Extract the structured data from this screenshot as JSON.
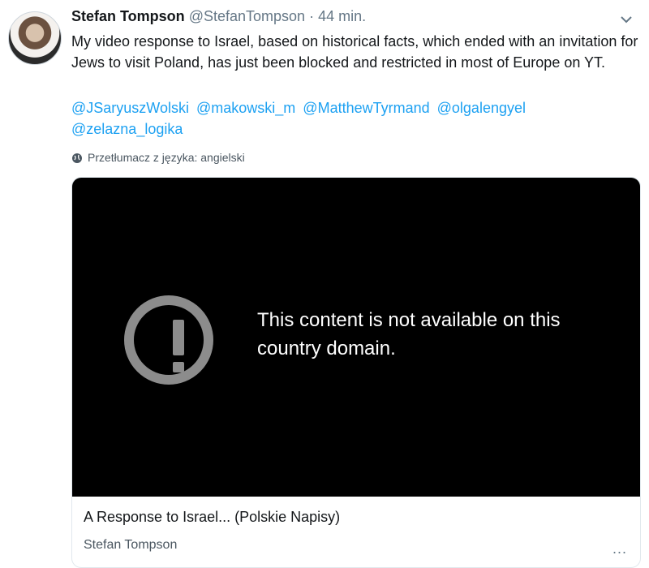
{
  "tweet": {
    "author_name": "Stefan Tompson",
    "author_handle": "@StefanTompson",
    "separator": "·",
    "time": "44 min.",
    "text": "My video response to Israel, based on historical facts, which ended with an invitation for Jews to visit Poland, has just been blocked and restricted in most of Europe on YT.",
    "mentions": [
      "@JSaryuszWolski",
      "@makowski_m",
      "@MatthewTyrmand",
      "@olgalengyel",
      "@zelazna_logika"
    ],
    "translate_label": "Przetłumacz z języka: angielski"
  },
  "card": {
    "blocked_message": "This content is not available on this country domain.",
    "title": "A Response to Israel... (Polskie Napisy)",
    "source": "Stefan Tompson",
    "more_symbol": "..."
  },
  "icons": {
    "caret": "chevron-down-icon",
    "globe": "globe-icon",
    "alert": "exclamation-circle-icon",
    "more": "more-horizontal-icon"
  },
  "colors": {
    "link": "#1da1f2",
    "muted": "#657786",
    "media_background": "#000000",
    "alert_gray": "#8c8c8c"
  }
}
